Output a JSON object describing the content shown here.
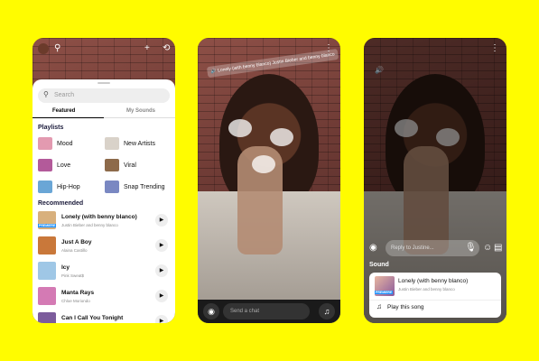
{
  "sheet": {
    "search_placeholder": "Search",
    "tabs": [
      "Featured",
      "My Sounds"
    ],
    "playlists_title": "Playlists",
    "playlists": [
      {
        "label": "Mood",
        "color": "#e39ab0"
      },
      {
        "label": "New Artists",
        "color": "#d9d2c9"
      },
      {
        "label": "Love",
        "color": "#b35a9a"
      },
      {
        "label": "Viral",
        "color": "#8d6a4a"
      },
      {
        "label": "Hip-Hop",
        "color": "#6aa6d6"
      },
      {
        "label": "Snap Trending",
        "color": "#7a88c2"
      }
    ],
    "recommended_title": "Recommended",
    "recommended": [
      {
        "title": "Lonely (with benny blanco)",
        "artist": "Justin Bieber and benny blanco",
        "badge": "PREMIERE",
        "color": "#d8b07d"
      },
      {
        "title": "Just A Boy",
        "artist": "Alaina Castillo",
        "color": "#c9783a"
      },
      {
        "title": "Icy",
        "artist": "Pink Sweat$",
        "color": "#9fc7e6"
      },
      {
        "title": "Manta Rays",
        "artist": "Chloe Moriondo",
        "color": "#d47ab4"
      },
      {
        "title": "Can I Call You Tonight",
        "artist": "",
        "color": "#7c5c9c"
      }
    ]
  },
  "camera": {
    "sticker_text": "Lonely (with benny blanco) Justin Bieber and benny blanco",
    "chat_placeholder": "Send a chat"
  },
  "reply": {
    "placeholder": "Reply to Justine...",
    "sound_label": "Sound",
    "song_title": "Lonely (with benny blanco)",
    "song_artist": "Justin Bieber and benny blanco",
    "badge": "PREMIERE",
    "play_label": "Play this song"
  }
}
